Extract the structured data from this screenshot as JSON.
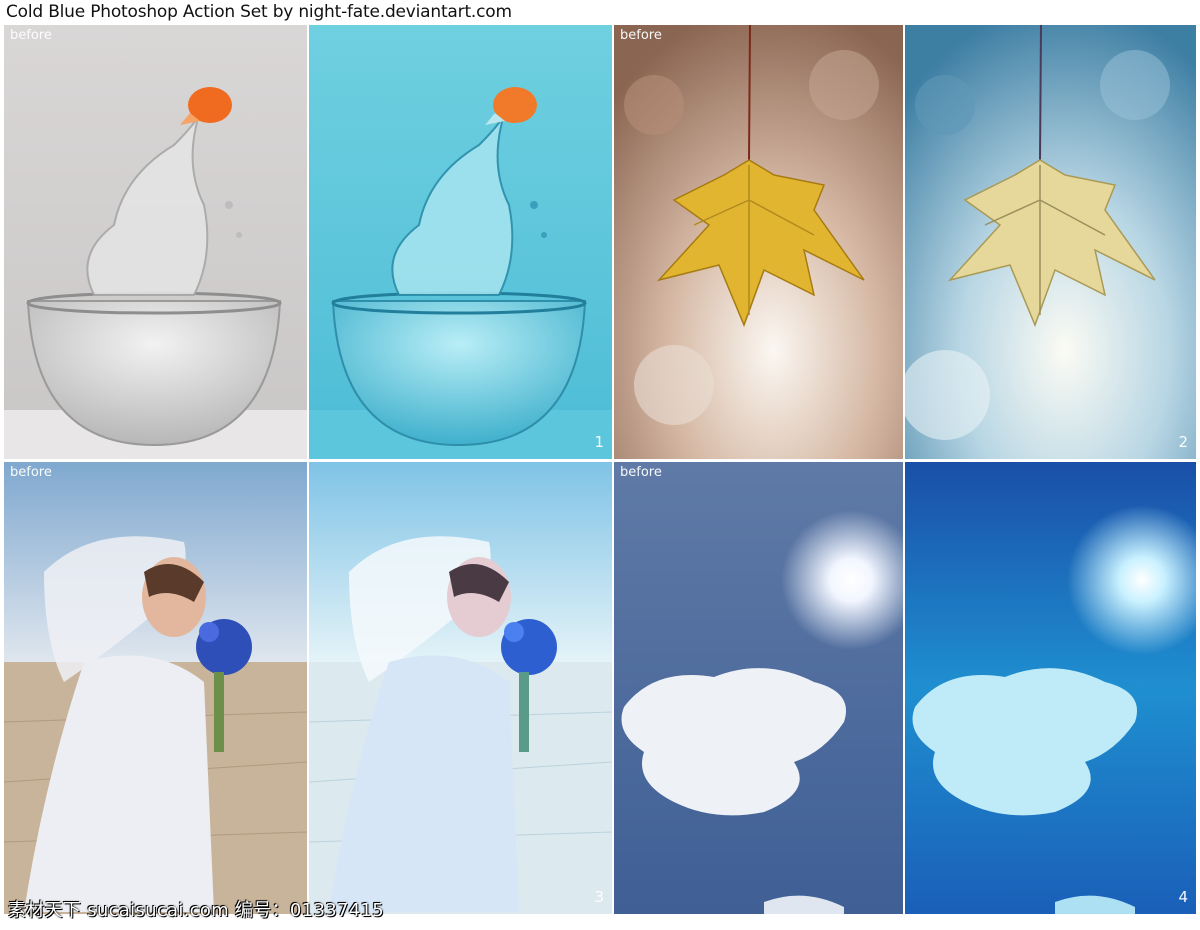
{
  "title": "Cold Blue Photoshop Action Set by night-fate.deviantart.com",
  "before_label": "before",
  "panels": [
    {
      "name": "goldfish-before",
      "subject": "goldfish jumping from glass bowl",
      "label": "before"
    },
    {
      "name": "goldfish-after",
      "subject": "goldfish jumping from glass bowl",
      "label": "1"
    },
    {
      "name": "leaf-before",
      "subject": "yellow maple leaf",
      "label": "before"
    },
    {
      "name": "leaf-after",
      "subject": "yellow maple leaf",
      "label": "2"
    },
    {
      "name": "bride-before",
      "subject": "bride with blue bouquet",
      "label": "before"
    },
    {
      "name": "bride-after",
      "subject": "bride with blue bouquet",
      "label": "3"
    },
    {
      "name": "sky-before",
      "subject": "sun and cloud in sky",
      "label": "before"
    },
    {
      "name": "sky-after",
      "subject": "sun and cloud in sky",
      "label": "4"
    }
  ],
  "watermark": "素材天下 sucaisucai.com  编号：01337415"
}
